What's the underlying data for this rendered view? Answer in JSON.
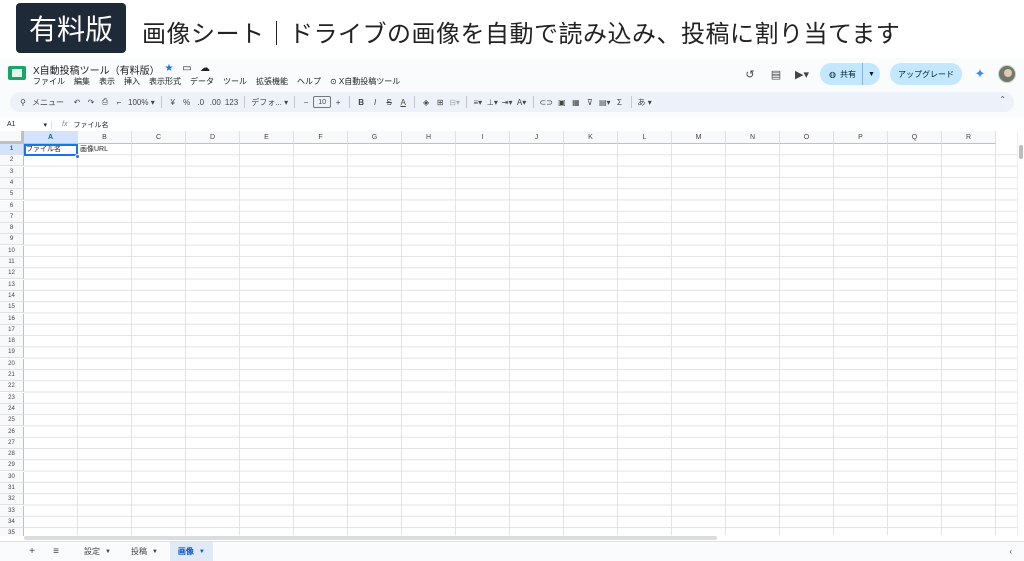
{
  "banner": {
    "badge": "有料版",
    "title": "画像シート｜ドライブの画像を自動で読み込み、投稿に割り当てます"
  },
  "app": {
    "doc_title": "X自動投稿ツール（有料版）",
    "menu": [
      "ファイル",
      "編集",
      "表示",
      "挿入",
      "表示形式",
      "データ",
      "ツール",
      "拡張機能",
      "ヘルプ",
      "⊙ X自動投稿ツール"
    ],
    "share_label": "共有",
    "upgrade_label": "アップグレード"
  },
  "toolbar": {
    "menu_search": "メニュー",
    "zoom": "100%",
    "currency": "¥",
    "percent": "%",
    "dec_decrease": ".0",
    "dec_increase": ".00",
    "number_format": "123",
    "font": "デフォ...",
    "font_size": "10",
    "input_mode": "あ"
  },
  "formula_bar": {
    "cell_ref": "A1",
    "fx": "fx",
    "value": "ファイル名"
  },
  "grid": {
    "columns": [
      "A",
      "B",
      "C",
      "D",
      "E",
      "F",
      "G",
      "H",
      "I",
      "J",
      "K",
      "L",
      "M",
      "N",
      "O",
      "P",
      "Q",
      "R"
    ],
    "rows": [
      "1",
      "2",
      "3",
      "4",
      "5",
      "6",
      "7",
      "8",
      "9",
      "10",
      "11",
      "12",
      "13",
      "14",
      "15",
      "16",
      "17",
      "18",
      "19",
      "20",
      "21",
      "22",
      "23",
      "24",
      "25",
      "26",
      "27",
      "28",
      "29",
      "30",
      "31",
      "32",
      "33",
      "34",
      "35"
    ],
    "cells": {
      "A1": "ファイル名",
      "B1": "画像URL"
    }
  },
  "sheets": {
    "tabs": [
      {
        "label": "設定",
        "active": false
      },
      {
        "label": "投稿",
        "active": false
      },
      {
        "label": "画像",
        "active": true
      }
    ]
  }
}
